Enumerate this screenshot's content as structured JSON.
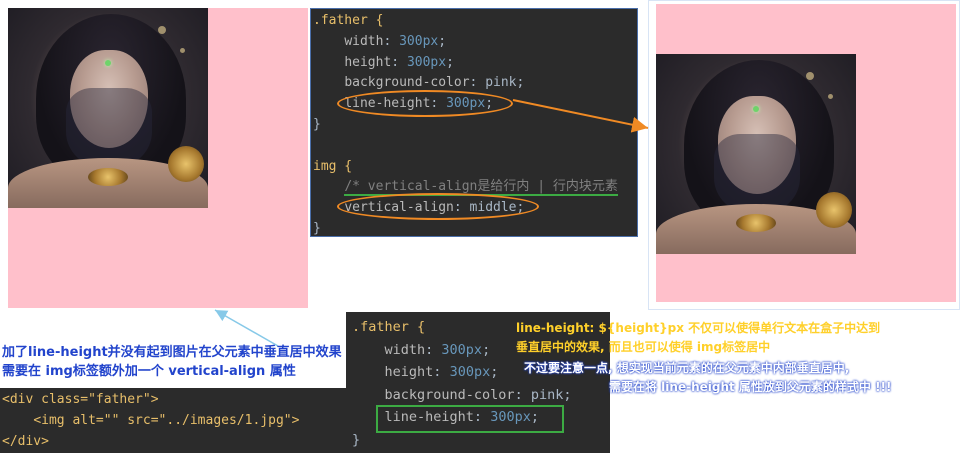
{
  "colors": {
    "pink": "#ffc0cb",
    "editor_bg": "#2b2b2b",
    "highlight_orange": "#f08a24",
    "highlight_green": "#3cab43",
    "caption_blue": "#2244cc",
    "caption_yellow": "#ffd02a"
  },
  "css_panel_top": {
    "lines": [
      {
        "sel": ".father {"
      },
      {
        "prop": "width",
        "val": "300px"
      },
      {
        "prop": "height",
        "val": "300px"
      },
      {
        "prop": "background-color",
        "val": "pink"
      },
      {
        "prop": "line-height",
        "val": "300px"
      },
      {
        "close": "}"
      },
      {
        "blank": ""
      },
      {
        "sel": "img {"
      },
      {
        "comment": "/* vertical-align是给行内 | 行内块元素"
      },
      {
        "prop": "vertical-align",
        "val": "middle"
      },
      {
        "close": "}"
      }
    ]
  },
  "css_panel_bottom": {
    "lines": [
      {
        "sel": ".father {"
      },
      {
        "prop": "width",
        "val": "300px"
      },
      {
        "prop": "height",
        "val": "300px"
      },
      {
        "prop": "background-color",
        "val": "pink"
      },
      {
        "prop": "line-height",
        "val": "300px"
      },
      {
        "close": "}"
      }
    ]
  },
  "html_panel": {
    "line1": "<div class=\"father\">",
    "line2": "<img alt=\"\" src=\"../images/1.jpg\">",
    "line3": "</div>"
  },
  "captions": {
    "left_line1": "加了line-height并没有起到图片在父元素中垂直居中效果",
    "left_line2": "需要在 img标签额外加一个 vertical-align 属性",
    "right_line1": "line-height: ${height}px 不仅可以使得单行文本在盒子中达到",
    "right_line2": "垂直居中的效果, 而且也可以使得 img标签居中",
    "right_line3": "不过要注意一点, 想实现当前元素的在父元素中内部垂直居中,",
    "right_line4": "需要在将 line-height 属性放到父元素的样式中 !!!"
  }
}
